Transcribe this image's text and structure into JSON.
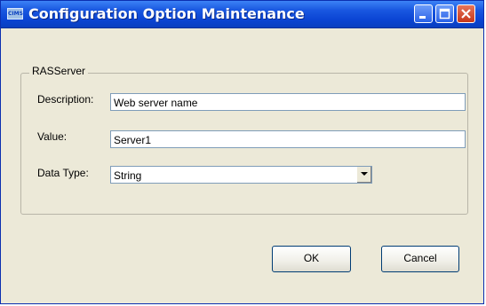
{
  "window": {
    "title": "Configuration Option Maintenance",
    "icon_text": "CIMS"
  },
  "titlebar_buttons": {
    "minimize": "minimize-icon",
    "maximize": "maximize-icon",
    "close": "close-icon"
  },
  "group": {
    "label": "RASServer"
  },
  "form": {
    "description_label": "Description:",
    "description_value": "Web server name",
    "value_label": "Value:",
    "value_value": "Server1",
    "datatype_label": "Data Type:",
    "datatype_value": "String"
  },
  "buttons": {
    "ok": "OK",
    "cancel": "Cancel"
  },
  "colors": {
    "titlebar": "#0b45d4",
    "dialog_bg": "#ece9d8",
    "close_button": "#c7371a"
  }
}
